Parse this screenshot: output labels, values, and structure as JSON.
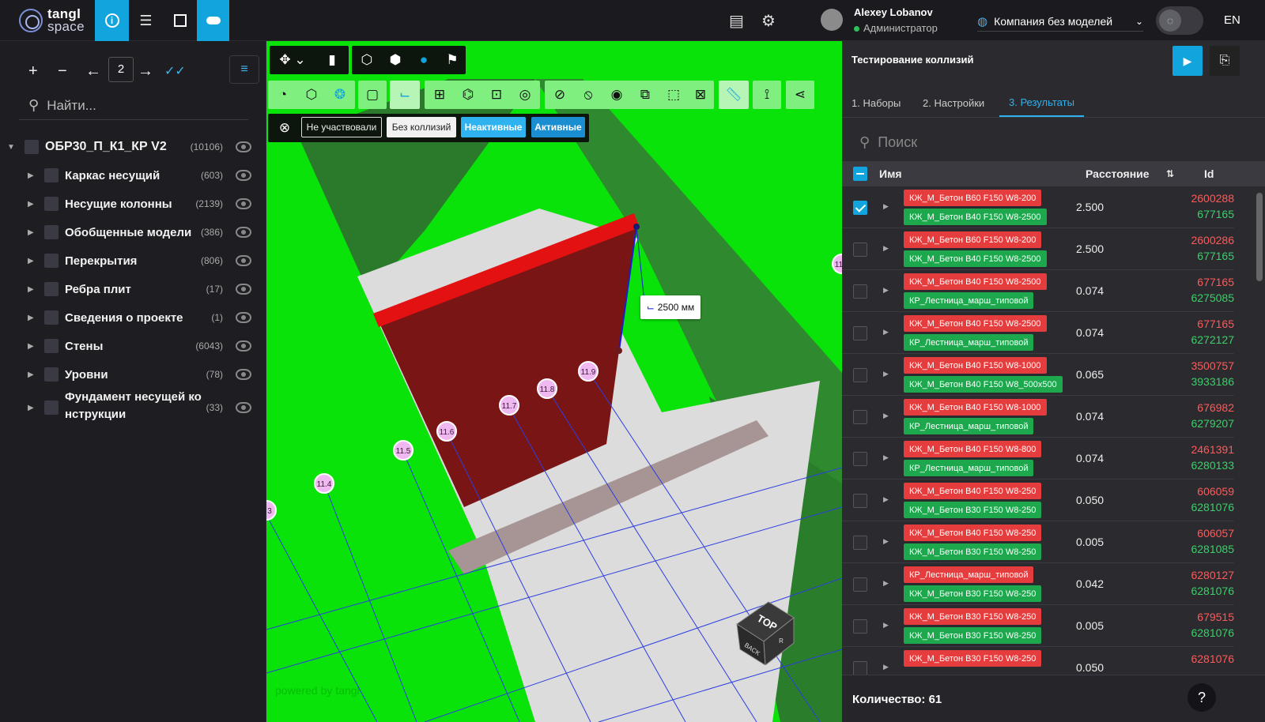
{
  "topbar": {
    "logo_line1": "tangl",
    "logo_line2": "space",
    "user_name": "Alexey Lobanov",
    "user_role": "Администратор",
    "company": "Компания без моделей",
    "lang": "EN"
  },
  "left": {
    "page": "2",
    "search_placeholder": "Найти...",
    "root": {
      "label": "ОБР30_П_К1_КР V2",
      "count": "(10106)"
    },
    "items": [
      {
        "label": "Каркас несущий",
        "count": "(603)"
      },
      {
        "label": "Несущие колонны",
        "count": "(2139)"
      },
      {
        "label": "Обобщенные модели",
        "count": "(386)"
      },
      {
        "label": "Перекрытия",
        "count": "(806)"
      },
      {
        "label": "Ребра плит",
        "count": "(17)"
      },
      {
        "label": "Сведения о проекте",
        "count": "(1)"
      },
      {
        "label": "Стены",
        "count": "(6043)"
      },
      {
        "label": "Уровни",
        "count": "(78)"
      },
      {
        "label": "Фундамент несущей ко",
        "label2": "нструкции",
        "count": "(33)"
      }
    ]
  },
  "viewport": {
    "filters": {
      "not_participated": "Не участвовали",
      "no_collisions": "Без коллизий",
      "inactive": "Неактивные",
      "active": "Активные"
    },
    "dimension": "2500 мм",
    "grid_labels": [
      "11.4",
      "11.5",
      "11.6",
      "11.7",
      "11.8",
      "11.9"
    ],
    "edge_labels": {
      "left": "3",
      "right": "11"
    },
    "powered": "powered by tangl",
    "cube_top": "TOP",
    "cube_back": "BACK",
    "cube_right": "R"
  },
  "right": {
    "title": "Тестирование коллизий",
    "tabs": [
      "1. Наборы",
      "2. Настройки",
      "3. Результаты"
    ],
    "active_tab": 2,
    "search_placeholder": "Поиск",
    "headers": {
      "name": "Имя",
      "distance": "Расстояние",
      "id": "Id"
    },
    "rows": [
      {
        "a": "КЖ_М_Бетон В60 F150 W8-200",
        "b": "КЖ_М_Бетон В40 F150 W8-2500",
        "dist": "2.500",
        "id1": "2600288",
        "id2": "677165",
        "checked": true
      },
      {
        "a": "КЖ_М_Бетон В60 F150 W8-200",
        "b": "КЖ_М_Бетон В40 F150 W8-2500",
        "dist": "2.500",
        "id1": "2600286",
        "id2": "677165",
        "checked": false
      },
      {
        "a": "КЖ_М_Бетон В40 F150 W8-2500",
        "b": "КР_Лестница_марш_типовой",
        "dist": "0.074",
        "id1": "677165",
        "id2": "6275085",
        "checked": false
      },
      {
        "a": "КЖ_М_Бетон В40 F150 W8-2500",
        "b": "КР_Лестница_марш_типовой",
        "dist": "0.074",
        "id1": "677165",
        "id2": "6272127",
        "checked": false
      },
      {
        "a": "КЖ_М_Бетон В40 F150 W8-1000",
        "b": "КЖ_М_Бетон В40 F150 W8_500х500",
        "dist": "0.065",
        "id1": "3500757",
        "id2": "3933186",
        "checked": false
      },
      {
        "a": "КЖ_М_Бетон В40 F150 W8-1000",
        "b": "КР_Лестница_марш_типовой",
        "dist": "0.074",
        "id1": "676982",
        "id2": "6279207",
        "checked": false
      },
      {
        "a": "КЖ_М_Бетон В40 F150 W8-800",
        "b": "КР_Лестница_марш_типовой",
        "dist": "0.074",
        "id1": "2461391",
        "id2": "6280133",
        "checked": false
      },
      {
        "a": "КЖ_М_Бетон В40 F150 W8-250",
        "b": "КЖ_М_Бетон В30 F150 W8-250",
        "dist": "0.050",
        "id1": "606059",
        "id2": "6281076",
        "checked": false
      },
      {
        "a": "КЖ_М_Бетон В40 F150 W8-250",
        "b": "КЖ_М_Бетон В30 F150 W8-250",
        "dist": "0.005",
        "id1": "606057",
        "id2": "6281085",
        "checked": false
      },
      {
        "a": "КР_Лестница_марш_типовой",
        "b": "КЖ_М_Бетон В30 F150 W8-250",
        "dist": "0.042",
        "id1": "6280127",
        "id2": "6281076",
        "checked": false
      },
      {
        "a": "КЖ_М_Бетон В30 F150 W8-250",
        "b": "КЖ_М_Бетон В30 F150 W8-250",
        "dist": "0.005",
        "id1": "679515",
        "id2": "6281076",
        "checked": false
      },
      {
        "a": "КЖ_М_Бетон В30 F150 W8-250",
        "b": "",
        "dist": "0.050",
        "id1": "6281076",
        "id2": "",
        "checked": false
      }
    ],
    "count_label": "Количество: 61",
    "help": "?"
  },
  "colors": {
    "accent": "#12a4dc",
    "viewport_bg": "#09e309",
    "collision_red": "#e53d3d",
    "collision_green": "#1ea84e"
  }
}
